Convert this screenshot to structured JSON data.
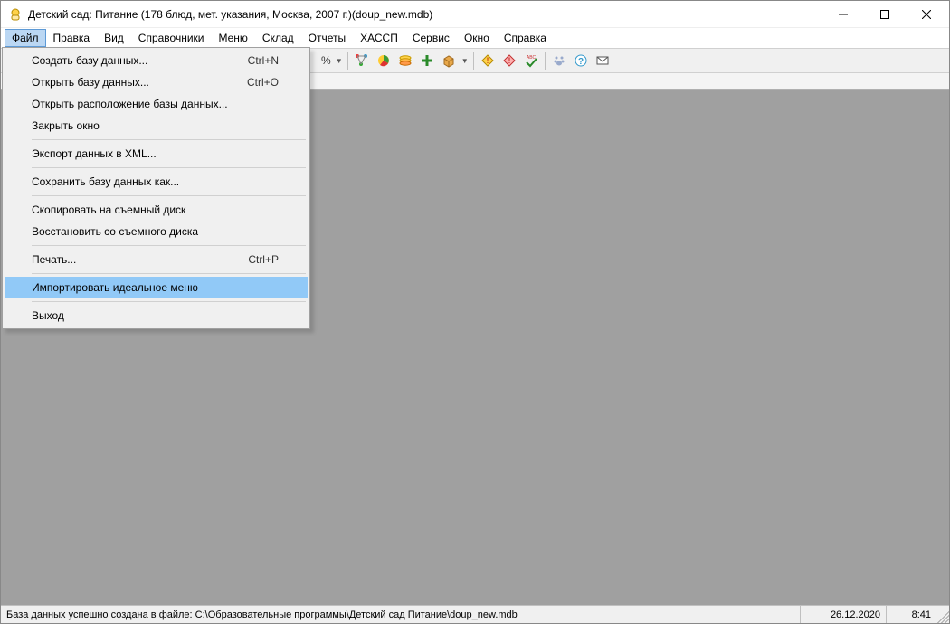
{
  "window": {
    "title": "Детский сад: Питание (178 блюд, мет. указания, Москва, 2007 г.)(doup_new.mdb)"
  },
  "menubar": {
    "items": [
      {
        "label": "Файл",
        "active": true
      },
      {
        "label": "Правка"
      },
      {
        "label": "Вид"
      },
      {
        "label": "Справочники"
      },
      {
        "label": "Меню"
      },
      {
        "label": "Склад"
      },
      {
        "label": "Отчеты"
      },
      {
        "label": "ХАССП"
      },
      {
        "label": "Сервис"
      },
      {
        "label": "Окно"
      },
      {
        "label": "Справка"
      }
    ]
  },
  "toolbar": {
    "percent_label": "%"
  },
  "file_menu": {
    "items": [
      {
        "label": "Создать базу данных...",
        "shortcut": "Ctrl+N"
      },
      {
        "label": "Открыть базу данных...",
        "shortcut": "Ctrl+O"
      },
      {
        "label": "Открыть расположение базы данных..."
      },
      {
        "label": "Закрыть окно"
      },
      {
        "sep": true
      },
      {
        "label": "Экспорт данных в XML..."
      },
      {
        "sep": true
      },
      {
        "label": "Сохранить базу данных как..."
      },
      {
        "sep": true
      },
      {
        "label": "Скопировать на съемный диск"
      },
      {
        "label": "Восстановить со съемного диска"
      },
      {
        "sep": true
      },
      {
        "label": "Печать...",
        "shortcut": "Ctrl+P"
      },
      {
        "sep": true
      },
      {
        "label": "Импортировать идеальное меню",
        "highlight": true
      },
      {
        "sep": true
      },
      {
        "label": "Выход"
      }
    ]
  },
  "statusbar": {
    "message": "База данных успешно создана в файле: C:\\Образовательные программы\\Детский сад Питание\\doup_new.mdb",
    "date": "26.12.2020",
    "time": "8:41"
  }
}
